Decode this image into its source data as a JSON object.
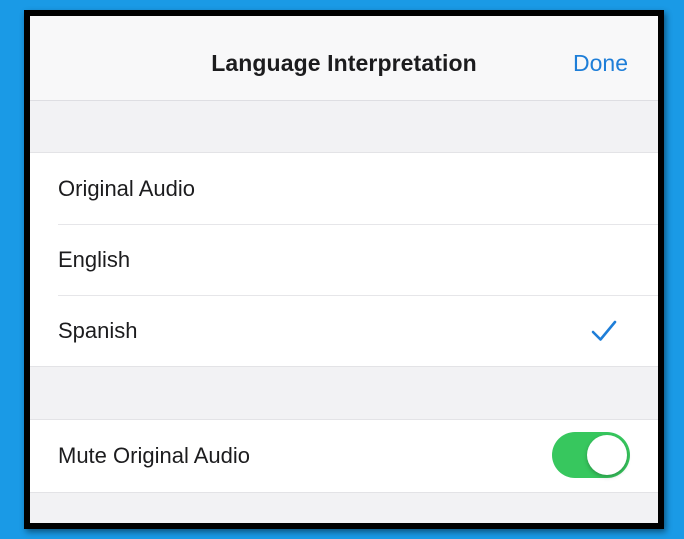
{
  "header": {
    "title": "Language Interpretation",
    "done_label": "Done"
  },
  "languages": {
    "options": [
      {
        "label": "Original Audio",
        "selected": false
      },
      {
        "label": "English",
        "selected": false
      },
      {
        "label": "Spanish",
        "selected": true
      }
    ],
    "checkmark_icon": "checkmark-icon"
  },
  "mute": {
    "label": "Mute Original Audio",
    "enabled": true
  },
  "colors": {
    "background": "#1a9ae6",
    "accent_blue": "#1e7ed8",
    "toggle_on": "#37c75e"
  }
}
